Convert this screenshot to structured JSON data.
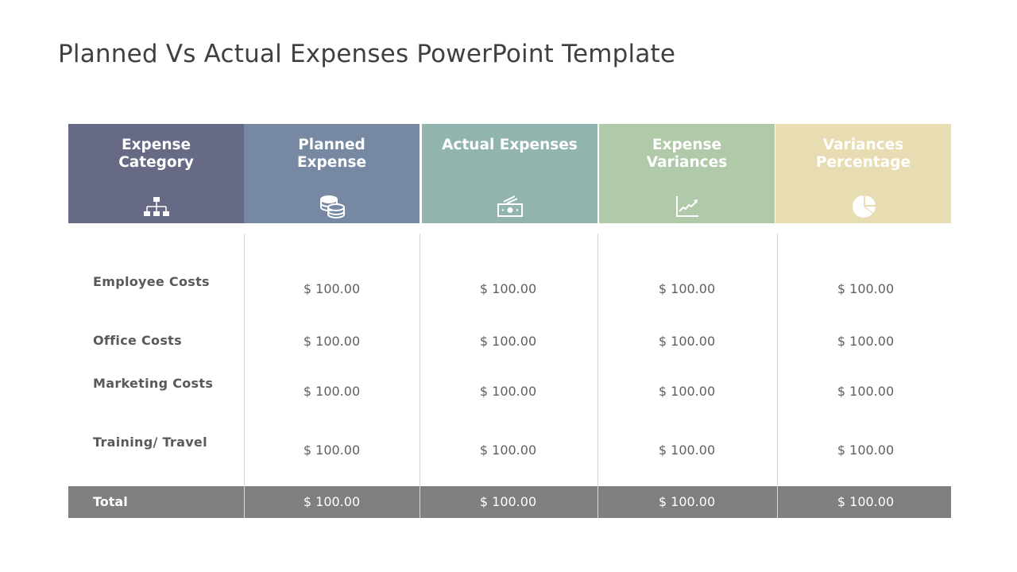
{
  "slide": {
    "title": "Planned Vs Actual Expenses PowerPoint Template"
  },
  "table": {
    "headers": [
      {
        "label": "Expense\nCategory",
        "icon": "hierarchy-icon",
        "color": "#676a84"
      },
      {
        "label": "Planned\nExpense",
        "icon": "coins-icon",
        "color": "#7688a2"
      },
      {
        "label": "Actual Expenses",
        "icon": "money-bills-icon",
        "color": "#91b5ae"
      },
      {
        "label": "Expense\nVariances",
        "icon": "growth-chart-icon",
        "color": "#b0c9a9"
      },
      {
        "label": "Variances\nPercentage",
        "icon": "pie-chart-icon",
        "color": "#e8dcb3"
      }
    ],
    "rows": [
      {
        "category": "Employee  Costs",
        "values": [
          "$ 100.00",
          "$ 100.00",
          "$ 100.00",
          "$ 100.00"
        ]
      },
      {
        "category": "Office Costs",
        "values": [
          "$ 100.00",
          "$ 100.00",
          "$ 100.00",
          "$ 100.00"
        ]
      },
      {
        "category": "Marketing  Costs",
        "values": [
          "$ 100.00",
          "$ 100.00",
          "$ 100.00",
          "$ 100.00"
        ]
      },
      {
        "category": "Training/  Travel",
        "values": [
          "$ 100.00",
          "$ 100.00",
          "$ 100.00",
          "$ 100.00"
        ]
      }
    ],
    "total": {
      "label": "Total",
      "values": [
        "$ 100.00",
        "$ 100.00",
        "$ 100.00",
        "$ 100.00"
      ],
      "color": "#7f7f7f"
    }
  }
}
